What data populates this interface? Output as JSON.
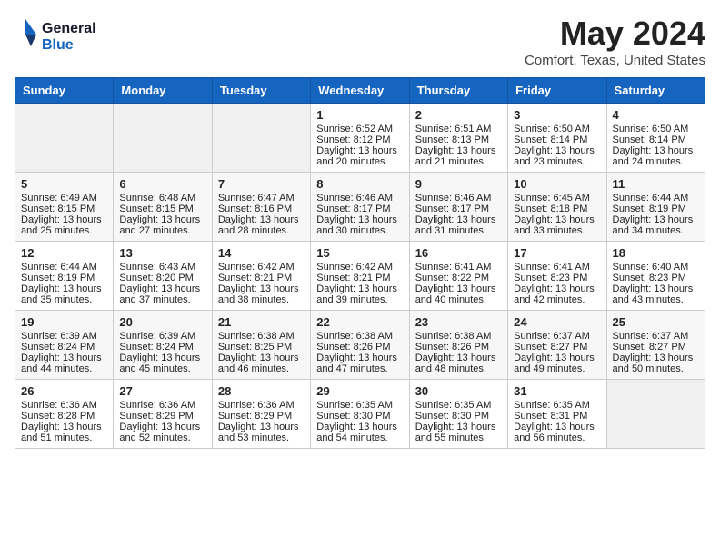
{
  "header": {
    "logo_line1": "General",
    "logo_line2": "Blue",
    "month": "May 2024",
    "location": "Comfort, Texas, United States"
  },
  "weekdays": [
    "Sunday",
    "Monday",
    "Tuesday",
    "Wednesday",
    "Thursday",
    "Friday",
    "Saturday"
  ],
  "weeks": [
    [
      {
        "day": "",
        "info": ""
      },
      {
        "day": "",
        "info": ""
      },
      {
        "day": "",
        "info": ""
      },
      {
        "day": "1",
        "info": "Sunrise: 6:52 AM\nSunset: 8:12 PM\nDaylight: 13 hours and 20 minutes."
      },
      {
        "day": "2",
        "info": "Sunrise: 6:51 AM\nSunset: 8:13 PM\nDaylight: 13 hours and 21 minutes."
      },
      {
        "day": "3",
        "info": "Sunrise: 6:50 AM\nSunset: 8:14 PM\nDaylight: 13 hours and 23 minutes."
      },
      {
        "day": "4",
        "info": "Sunrise: 6:50 AM\nSunset: 8:14 PM\nDaylight: 13 hours and 24 minutes."
      }
    ],
    [
      {
        "day": "5",
        "info": "Sunrise: 6:49 AM\nSunset: 8:15 PM\nDaylight: 13 hours and 25 minutes."
      },
      {
        "day": "6",
        "info": "Sunrise: 6:48 AM\nSunset: 8:15 PM\nDaylight: 13 hours and 27 minutes."
      },
      {
        "day": "7",
        "info": "Sunrise: 6:47 AM\nSunset: 8:16 PM\nDaylight: 13 hours and 28 minutes."
      },
      {
        "day": "8",
        "info": "Sunrise: 6:46 AM\nSunset: 8:17 PM\nDaylight: 13 hours and 30 minutes."
      },
      {
        "day": "9",
        "info": "Sunrise: 6:46 AM\nSunset: 8:17 PM\nDaylight: 13 hours and 31 minutes."
      },
      {
        "day": "10",
        "info": "Sunrise: 6:45 AM\nSunset: 8:18 PM\nDaylight: 13 hours and 33 minutes."
      },
      {
        "day": "11",
        "info": "Sunrise: 6:44 AM\nSunset: 8:19 PM\nDaylight: 13 hours and 34 minutes."
      }
    ],
    [
      {
        "day": "12",
        "info": "Sunrise: 6:44 AM\nSunset: 8:19 PM\nDaylight: 13 hours and 35 minutes."
      },
      {
        "day": "13",
        "info": "Sunrise: 6:43 AM\nSunset: 8:20 PM\nDaylight: 13 hours and 37 minutes."
      },
      {
        "day": "14",
        "info": "Sunrise: 6:42 AM\nSunset: 8:21 PM\nDaylight: 13 hours and 38 minutes."
      },
      {
        "day": "15",
        "info": "Sunrise: 6:42 AM\nSunset: 8:21 PM\nDaylight: 13 hours and 39 minutes."
      },
      {
        "day": "16",
        "info": "Sunrise: 6:41 AM\nSunset: 8:22 PM\nDaylight: 13 hours and 40 minutes."
      },
      {
        "day": "17",
        "info": "Sunrise: 6:41 AM\nSunset: 8:23 PM\nDaylight: 13 hours and 42 minutes."
      },
      {
        "day": "18",
        "info": "Sunrise: 6:40 AM\nSunset: 8:23 PM\nDaylight: 13 hours and 43 minutes."
      }
    ],
    [
      {
        "day": "19",
        "info": "Sunrise: 6:39 AM\nSunset: 8:24 PM\nDaylight: 13 hours and 44 minutes."
      },
      {
        "day": "20",
        "info": "Sunrise: 6:39 AM\nSunset: 8:24 PM\nDaylight: 13 hours and 45 minutes."
      },
      {
        "day": "21",
        "info": "Sunrise: 6:38 AM\nSunset: 8:25 PM\nDaylight: 13 hours and 46 minutes."
      },
      {
        "day": "22",
        "info": "Sunrise: 6:38 AM\nSunset: 8:26 PM\nDaylight: 13 hours and 47 minutes."
      },
      {
        "day": "23",
        "info": "Sunrise: 6:38 AM\nSunset: 8:26 PM\nDaylight: 13 hours and 48 minutes."
      },
      {
        "day": "24",
        "info": "Sunrise: 6:37 AM\nSunset: 8:27 PM\nDaylight: 13 hours and 49 minutes."
      },
      {
        "day": "25",
        "info": "Sunrise: 6:37 AM\nSunset: 8:27 PM\nDaylight: 13 hours and 50 minutes."
      }
    ],
    [
      {
        "day": "26",
        "info": "Sunrise: 6:36 AM\nSunset: 8:28 PM\nDaylight: 13 hours and 51 minutes."
      },
      {
        "day": "27",
        "info": "Sunrise: 6:36 AM\nSunset: 8:29 PM\nDaylight: 13 hours and 52 minutes."
      },
      {
        "day": "28",
        "info": "Sunrise: 6:36 AM\nSunset: 8:29 PM\nDaylight: 13 hours and 53 minutes."
      },
      {
        "day": "29",
        "info": "Sunrise: 6:35 AM\nSunset: 8:30 PM\nDaylight: 13 hours and 54 minutes."
      },
      {
        "day": "30",
        "info": "Sunrise: 6:35 AM\nSunset: 8:30 PM\nDaylight: 13 hours and 55 minutes."
      },
      {
        "day": "31",
        "info": "Sunrise: 6:35 AM\nSunset: 8:31 PM\nDaylight: 13 hours and 56 minutes."
      },
      {
        "day": "",
        "info": ""
      }
    ]
  ]
}
